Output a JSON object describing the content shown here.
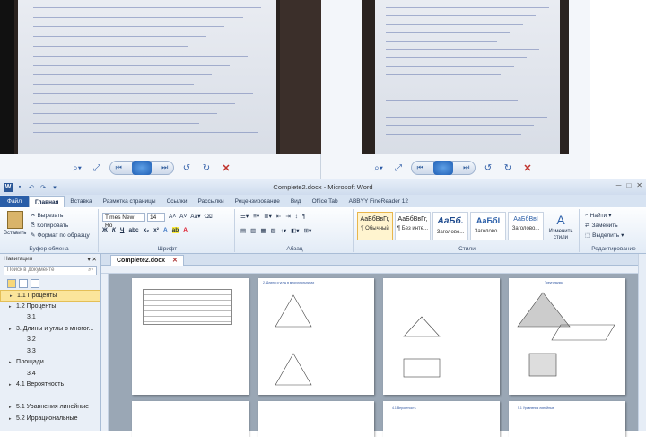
{
  "word": {
    "title": "Complete2.docx - Microsoft Word",
    "tabs": [
      "Файл",
      "Главная",
      "Вставка",
      "Разметка страницы",
      "Ссылки",
      "Рассылки",
      "Рецензирование",
      "Вид",
      "Office Tab",
      "ABBYY FineReader 12"
    ],
    "active_tab": "Главная",
    "clipboard": {
      "cut": "Вырезать",
      "copy": "Копировать",
      "format_painter": "Формат по образцу",
      "label": "Буфер обмена"
    },
    "font": {
      "name": "Times New Ro",
      "size": "14",
      "label": "Шрифт"
    },
    "paragraph_label": "Абзац",
    "styles_label": "Стили",
    "styles": [
      {
        "sample": "АаБбВвГг,",
        "name": "¶ Обычный"
      },
      {
        "sample": "АаБбВвГг,",
        "name": "¶ Без инте..."
      },
      {
        "sample": "АаБб.",
        "name": "Заголово..."
      },
      {
        "sample": "АаБбІ",
        "name": "Заголово..."
      },
      {
        "sample": "АаБбВвІ",
        "name": "Заголово..."
      }
    ],
    "change_styles": "Изменить стили",
    "editing": {
      "find": "Найти",
      "replace": "Заменить",
      "select": "Выделить",
      "label": "Редактирование"
    },
    "navigation": {
      "title": "Навигация",
      "search_placeholder": "Поиск в документе",
      "items": [
        {
          "label": "1.1 Проценты",
          "level": 1,
          "selected": true
        },
        {
          "label": "1.2 Проценты",
          "level": 1
        },
        {
          "label": "3.1",
          "level": 2
        },
        {
          "label": "3. Длины и углы в многог...",
          "level": 1
        },
        {
          "label": "3.2",
          "level": 2
        },
        {
          "label": "3.3",
          "level": 2
        },
        {
          "label": "Площади",
          "level": 1
        },
        {
          "label": "3.4",
          "level": 2
        },
        {
          "label": "4.1 Вероятность",
          "level": 1
        },
        {
          "label": "",
          "level": 1
        },
        {
          "label": "5.1 Уравнения линейные",
          "level": 1
        },
        {
          "label": "5.2 Иррациональные",
          "level": 1
        }
      ]
    },
    "doc_tab": "Complete2.docx",
    "page_headings": [
      "2. Длины и углы в многоугольниках",
      "Треугольник",
      "4.1 Вероятность",
      "5.1 Уравнения линейные"
    ]
  }
}
